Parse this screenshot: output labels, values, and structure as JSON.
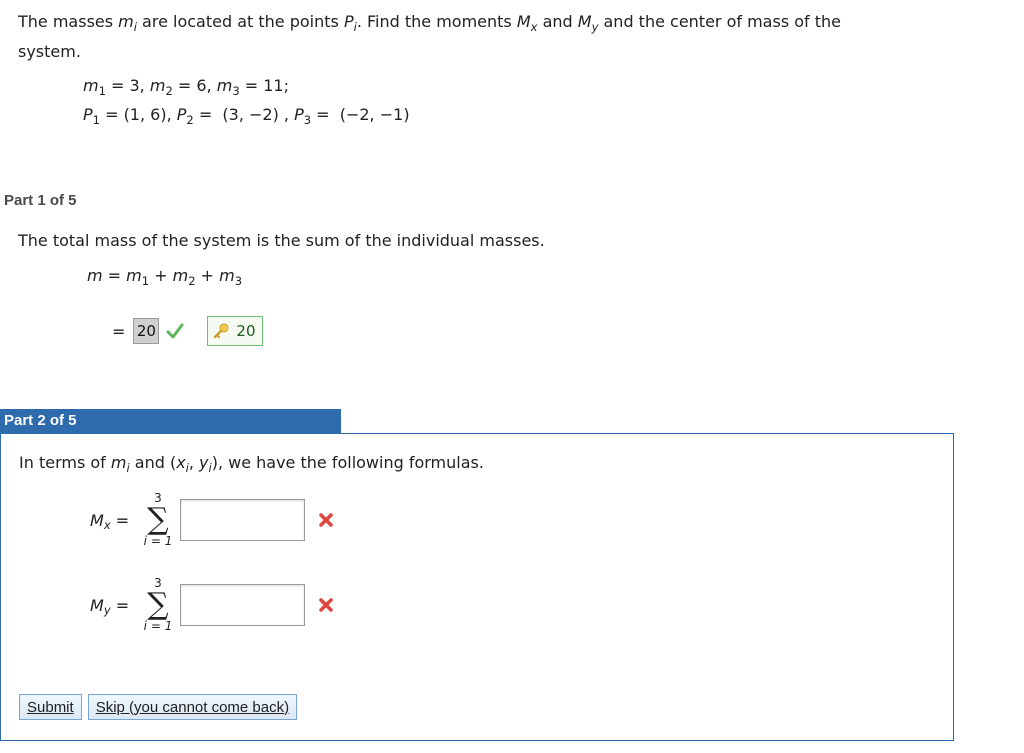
{
  "problem": {
    "line1": {
      "t1": "The masses ",
      "m": "m",
      "i1": "i",
      "t2": " are located at the points ",
      "p": "P",
      "i2": "i",
      "t3": ". Find the moments ",
      "mx": "M",
      "x": "x",
      "t4": " and ",
      "my": "M",
      "y": "y",
      "t5": " and the center of mass of the"
    },
    "line2": "system.",
    "masses": {
      "m1": "m",
      "s1": "1",
      "v1": " = 3, ",
      "m2": "m",
      "s2": "2",
      "v2": " = 6, ",
      "m3": "m",
      "s3": "3",
      "v3": " = 11;"
    },
    "points": {
      "p1": "P",
      "s1": "1",
      "v1": " = (1, 6), ",
      "p2": "P",
      "s2": "2",
      "v2": " =  (3, −2) , ",
      "p3": "P",
      "s3": "3",
      "v3": " =  (−2, −1)"
    }
  },
  "part1": {
    "title": "Part 1 of 5",
    "text": "The total mass of the system is the sum of the individual masses.",
    "formula": {
      "lhs": "m",
      "eq": " = ",
      "m1": "m",
      "s1": "1",
      "plus1": " + ",
      "m2": "m",
      "s2": "2",
      "plus2": " + ",
      "m3": "m",
      "s3": "3"
    },
    "equals": "=",
    "answer": "20",
    "key_answer": "20"
  },
  "part2": {
    "title": "Part 2 of 5",
    "text": {
      "t1": "In terms of ",
      "m": "m",
      "i": "i",
      "t2": " and (",
      "x": "x",
      "xi": "i",
      "comma": ", ",
      "y": "y",
      "yi": "i",
      "t3": "), we have the following formulas."
    },
    "mx": {
      "var": "M",
      "sub": "x",
      "eq": " =",
      "upper": "3",
      "sigma": "∑",
      "lower": "i = 1",
      "value": ""
    },
    "my": {
      "var": "M",
      "sub": "y",
      "eq": " =",
      "upper": "3",
      "sigma": "∑",
      "lower": "i = 1",
      "value": ""
    }
  },
  "buttons": {
    "submit": "Submit",
    "skip": "Skip (you cannot come back)"
  },
  "colors": {
    "header_blue": "#2e6bad",
    "check_green": "#5cb85c",
    "error_red": "#e0443a"
  }
}
